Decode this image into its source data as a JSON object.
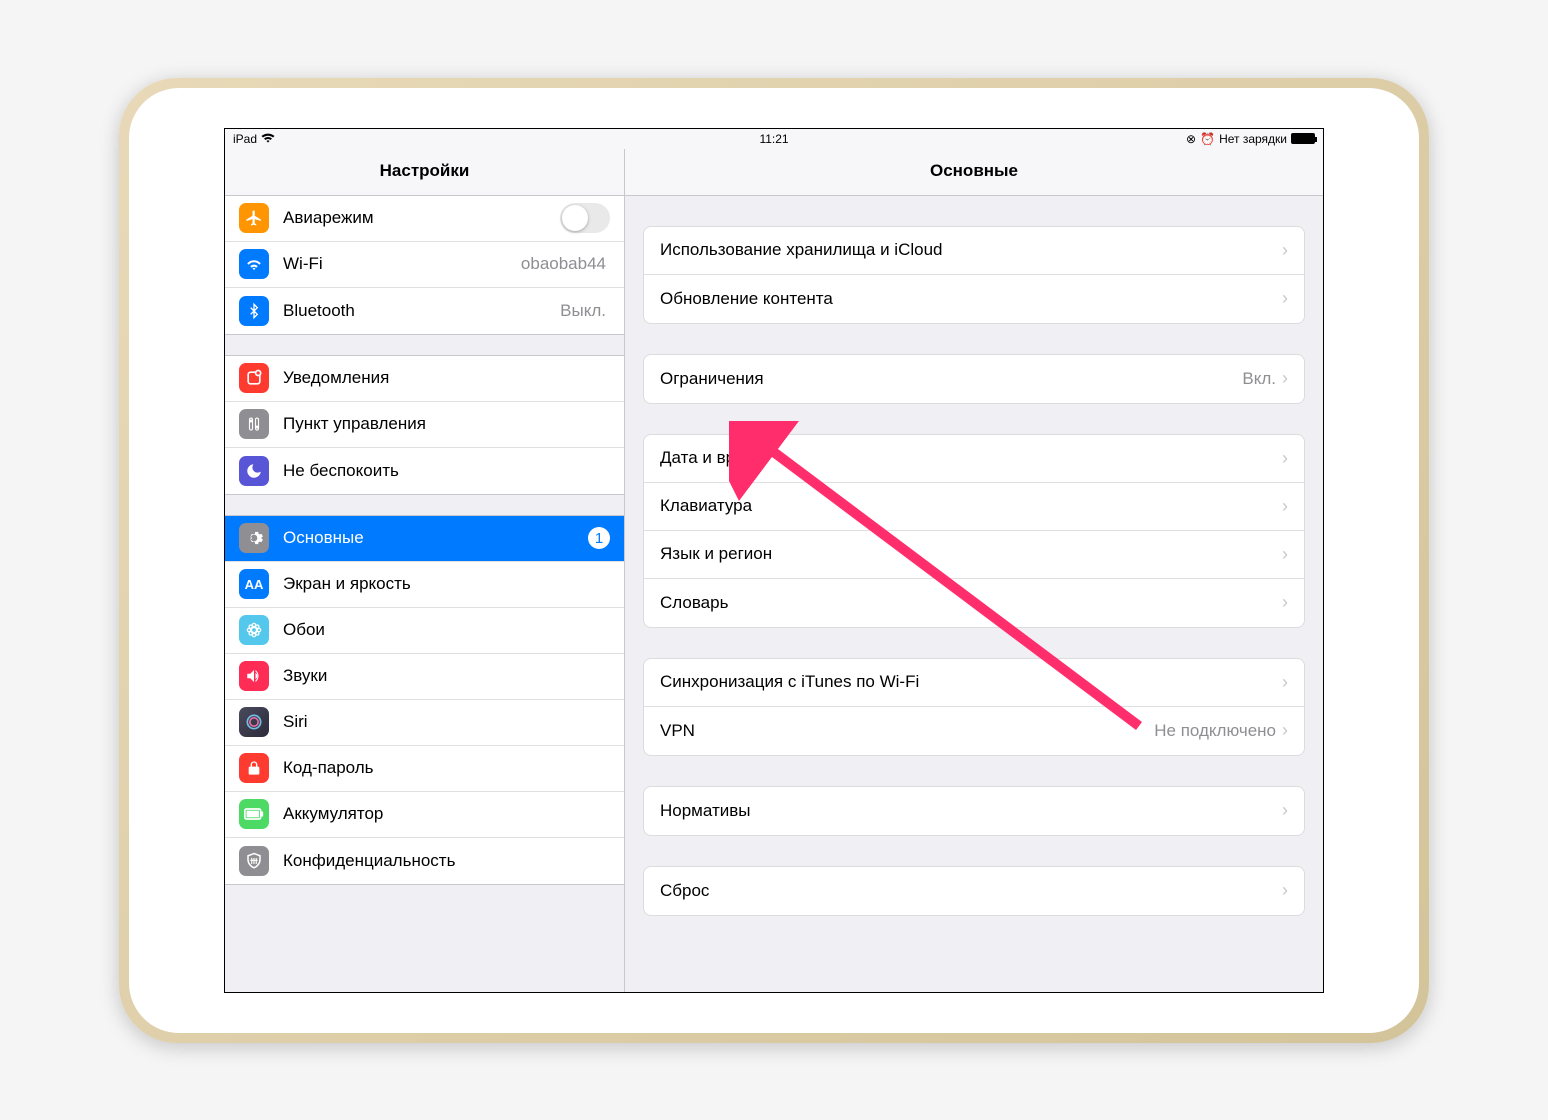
{
  "statusbar": {
    "device": "iPad",
    "time": "11:21",
    "battery_text": "Нет зарядки"
  },
  "sidebar": {
    "title": "Настройки",
    "sections": [
      [
        {
          "id": "airplane",
          "label": "Авиарежим",
          "icon_bg": "#ff9500",
          "type": "toggle"
        },
        {
          "id": "wifi",
          "label": "Wi-Fi",
          "detail": "obaobab44",
          "icon_bg": "#007aff"
        },
        {
          "id": "bluetooth",
          "label": "Bluetooth",
          "detail": "Выкл.",
          "icon_bg": "#007aff"
        }
      ],
      [
        {
          "id": "notifications",
          "label": "Уведомления",
          "icon_bg": "#ff3b30"
        },
        {
          "id": "control-center",
          "label": "Пункт управления",
          "icon_bg": "#8e8e93"
        },
        {
          "id": "dnd",
          "label": "Не беспокоить",
          "icon_bg": "#5856d6"
        }
      ],
      [
        {
          "id": "general",
          "label": "Основные",
          "icon_bg": "#8e8e93",
          "selected": true,
          "badge": "1"
        },
        {
          "id": "display",
          "label": "Экран и яркость",
          "icon_bg": "#007aff"
        },
        {
          "id": "wallpaper",
          "label": "Обои",
          "icon_bg": "#54c7ec"
        },
        {
          "id": "sounds",
          "label": "Звуки",
          "icon_bg": "#ff2d55"
        },
        {
          "id": "siri",
          "label": "Siri",
          "icon_bg": "#2b2b3a"
        },
        {
          "id": "passcode",
          "label": "Код-пароль",
          "icon_bg": "#ff3b30"
        },
        {
          "id": "battery",
          "label": "Аккумулятор",
          "icon_bg": "#4cd964"
        },
        {
          "id": "privacy",
          "label": "Конфиденциальность",
          "icon_bg": "#8e8e93"
        }
      ]
    ]
  },
  "detail": {
    "title": "Основные",
    "sections": [
      [
        {
          "id": "storage",
          "label": "Использование хранилища и iCloud"
        },
        {
          "id": "refresh",
          "label": "Обновление контента"
        }
      ],
      [
        {
          "id": "restrictions",
          "label": "Ограничения",
          "value": "Вкл."
        }
      ],
      [
        {
          "id": "datetime",
          "label": "Дата и время"
        },
        {
          "id": "keyboard",
          "label": "Клавиатура"
        },
        {
          "id": "language",
          "label": "Язык и регион"
        },
        {
          "id": "dictionary",
          "label": "Словарь"
        }
      ],
      [
        {
          "id": "itunes-wifi",
          "label": "Синхронизация с iTunes по Wi-Fi"
        },
        {
          "id": "vpn",
          "label": "VPN",
          "value": "Не подключено"
        }
      ],
      [
        {
          "id": "regulatory",
          "label": "Нормативы"
        }
      ],
      [
        {
          "id": "reset",
          "label": "Сброс"
        }
      ]
    ]
  },
  "icons": {
    "airplane": "✈",
    "wifi": "wifi",
    "bluetooth": "bt",
    "notifications": "notif",
    "control-center": "cc",
    "dnd": "☾",
    "general": "⚙",
    "display": "AA",
    "wallpaper": "✱",
    "sounds": "🔊",
    "siri": "siri",
    "passcode": "🔒",
    "battery": "bat",
    "privacy": "✋"
  }
}
